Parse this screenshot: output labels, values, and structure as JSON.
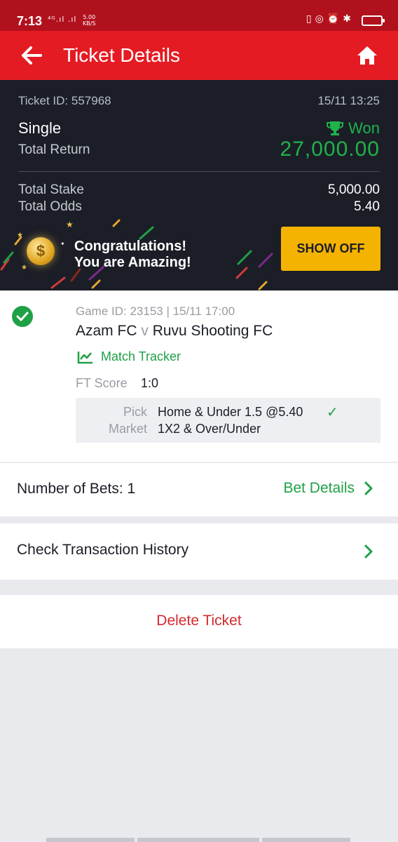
{
  "status_bar": {
    "time": "7:13",
    "network": "⁴ᴳ.ıl .ıl",
    "speed_value": "5.00",
    "speed_unit": "KB/S",
    "icons": [
      "vibrate-icon",
      "data-saver-icon",
      "alarm-icon",
      "bluetooth-icon",
      "battery-icon"
    ]
  },
  "header": {
    "title": "Ticket Details",
    "back_icon": "arrow-left-icon",
    "home_icon": "home-icon"
  },
  "summary": {
    "ticket_id": "Ticket ID: 557968",
    "ticket_time": "15/11 13:25",
    "bet_type": "Single",
    "status": "Won",
    "total_return_label": "Total Return",
    "total_return_value": "27,000.00",
    "total_stake_label": "Total Stake",
    "total_stake_value": "5,000.00",
    "total_odds_label": "Total Odds",
    "total_odds_value": "5.40",
    "congrats_line1": "Congratulations!",
    "congrats_line2": "You are Amazing!",
    "coin_symbol": "$",
    "show_off_label": "SHOW OFF"
  },
  "bet": {
    "game_id": "Game ID: 23153 | 15/11 17:00",
    "home_team": "Azam FC",
    "vs": "v",
    "away_team": "Ruvu Shooting FC",
    "tracker_label": "Match Tracker",
    "ft_score_label": "FT Score",
    "ft_score_value": "1:0",
    "pick_label": "Pick",
    "pick_value": "Home & Under 1.5 @5.40",
    "pick_check": "✓",
    "market_label": "Market",
    "market_value": "1X2 & Over/Under"
  },
  "rows": {
    "number_of_bets": "Number of Bets: 1",
    "bet_details": "Bet Details",
    "check_history": "Check Transaction History",
    "delete_ticket": "Delete Ticket"
  },
  "colors": {
    "brand_red": "#e41b23",
    "status_bar_red": "#b1111d",
    "dark_bg": "#1b1e27",
    "won_green": "#1fb34b",
    "show_off_yellow": "#f5b301",
    "delete_red": "#d42a2f"
  }
}
